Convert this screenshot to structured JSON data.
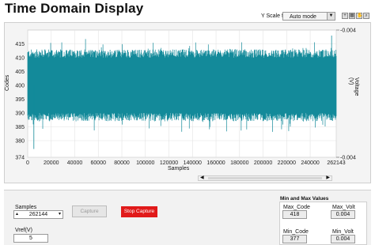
{
  "title": "Time Domain Display",
  "yscale": {
    "label": "Y Scale fit",
    "selected": "Auto mode"
  },
  "toolbar": {
    "icons": [
      "crosshair-icon",
      "zoom-icon",
      "pan-icon",
      "magnify-icon"
    ]
  },
  "chart_data": {
    "type": "line",
    "xlabel": "Samples",
    "ylabel_left": "Codes",
    "ylabel_right": "Voltage (V)",
    "xlim": [
      0,
      262143
    ],
    "ylim_left": [
      374,
      420
    ],
    "ylim_right_labels": [
      "0.004",
      "0.004"
    ],
    "x_ticks": [
      "0",
      "20000",
      "40000",
      "60000",
      "80000",
      "100000",
      "120000",
      "140000",
      "160000",
      "180000",
      "200000",
      "220000",
      "240000",
      "262143"
    ],
    "y_ticks": [
      "374",
      "380",
      "385",
      "390",
      "395",
      "400",
      "405",
      "410",
      "415"
    ],
    "series": [
      {
        "color": "#138a9a",
        "center": 400,
        "band_core": [
          390,
          410
        ],
        "min": 377,
        "max": 418
      }
    ],
    "grid": true
  },
  "controls": {
    "samples_label": "Samples",
    "samples_value": "262144",
    "vref_label": "Vref(V)",
    "vref_value": "5",
    "capture_label": "Capture",
    "stop_label": "Stop Capture"
  },
  "minmax": {
    "heading": "Min and Max Values",
    "max_code_label": "Max_Code",
    "max_code": "418",
    "max_volt_label": "Max_Volt",
    "max_volt": "0.004",
    "min_code_label": "Min_Code",
    "min_code": "377",
    "min_volt_label": "Min_Volt",
    "min_volt": "0.004"
  }
}
